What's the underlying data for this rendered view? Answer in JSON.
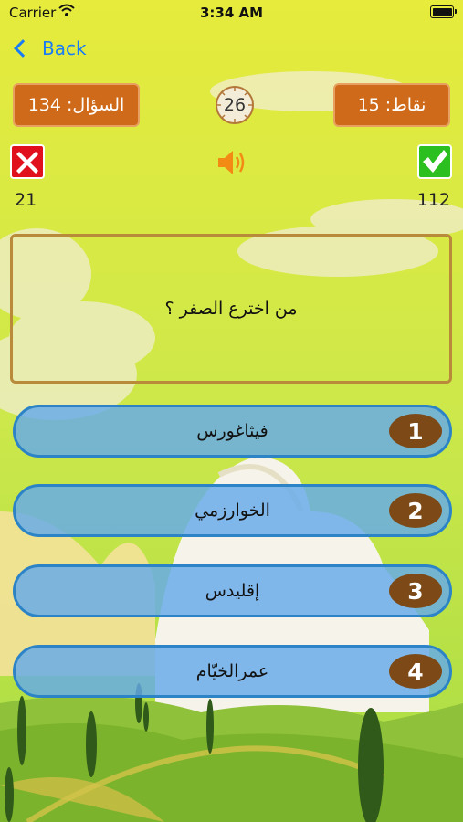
{
  "status_bar": {
    "carrier": "Carrier",
    "time": "3:34 AM"
  },
  "nav": {
    "back_label": "Back"
  },
  "header": {
    "question_counter": "السؤال: 134",
    "points": "نقاط: 15",
    "timer": "26"
  },
  "scores": {
    "wrong_count": "21",
    "correct_count": "112"
  },
  "question": {
    "text": "من اخترع الصفر ؟"
  },
  "answers": [
    {
      "number": "1",
      "label": "فيثاغورس"
    },
    {
      "number": "2",
      "label": "الخوارزمي"
    },
    {
      "number": "3",
      "label": "إقليدس"
    },
    {
      "number": "4",
      "label": "عمرالخيّام"
    }
  ],
  "colors": {
    "accent_orange": "#cf6a1a",
    "answer_blue": "#64aaeb",
    "wrong_red": "#e0101c",
    "right_green": "#2bbf1f",
    "number_brown": "#7d4a17"
  },
  "icons": [
    "wifi-icon",
    "battery-icon",
    "chevron-left-icon",
    "clock-icon",
    "wrong-x-icon",
    "speaker-icon",
    "check-icon"
  ]
}
